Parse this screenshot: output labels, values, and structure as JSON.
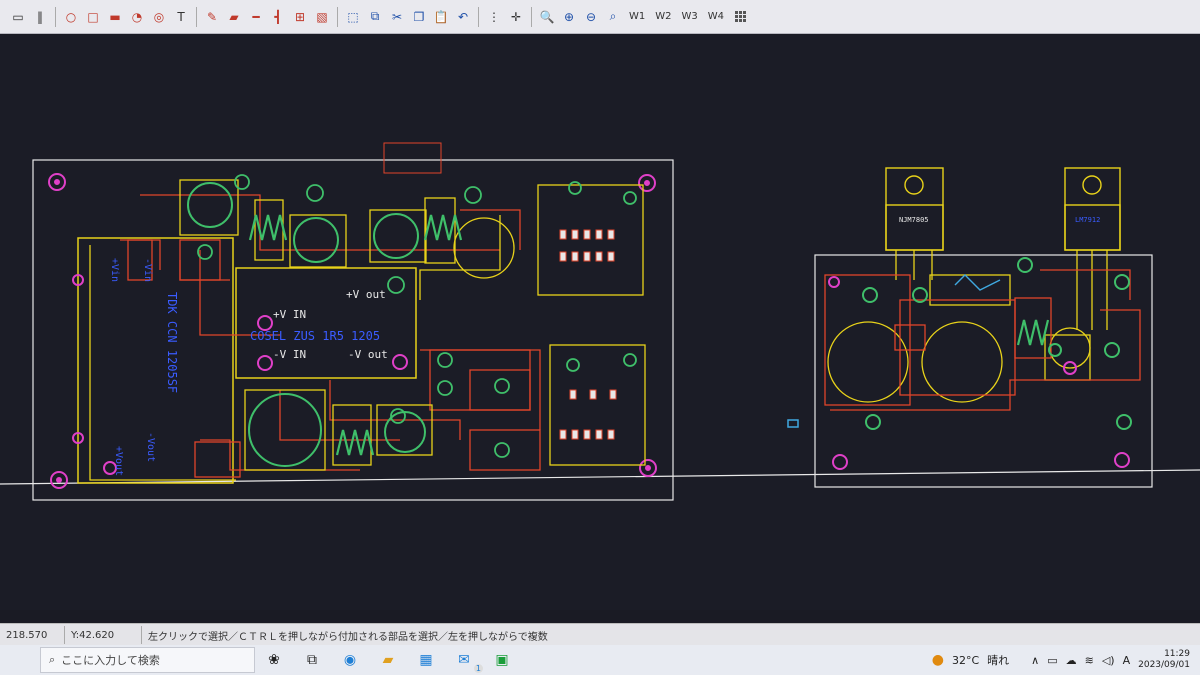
{
  "toolbar": {
    "text_tool": "T",
    "window_buttons": [
      "W1",
      "W2",
      "W3",
      "W4"
    ]
  },
  "board1": {
    "labels": {
      "v_in_plus": "+V IN",
      "v_out_plus": "+V out",
      "v_in_minus": "-V IN",
      "v_out_minus": "-V out",
      "cosel": "COSEL ZUS 1R5 1205",
      "tdk": "TDK CCN 1205SF",
      "vin_left": "+Vin",
      "vin_left2": "-Vin",
      "vout_bottom": "-Vout",
      "vout_bottom2": "+Vout"
    }
  },
  "board2": {
    "labels": {
      "reg1": "NJM7805",
      "reg2": "LM7912"
    }
  },
  "statusbar": {
    "x_coord": "218.570",
    "y_coord": "Y:42.620",
    "hint": "左クリックで選択／ＣＴＲＬを押しながら付加される部品を選択／左を押しながらで複数"
  },
  "taskbar": {
    "search_placeholder": "ここに入力して検索",
    "weather_temp": "32°C",
    "weather_text": "晴れ",
    "ime": "A",
    "time": "11:29",
    "date": "2023/09/01",
    "mail_badge": "1"
  },
  "colors": {
    "canvas_bg": "#1b1c26",
    "outline_white": "#e8e8e8",
    "trace_yellow": "#e8d21a",
    "trace_red": "#e0452b",
    "pad_green": "#3fbf6a",
    "pad_magenta": "#e040c8",
    "text_blue": "#3a5cff"
  }
}
